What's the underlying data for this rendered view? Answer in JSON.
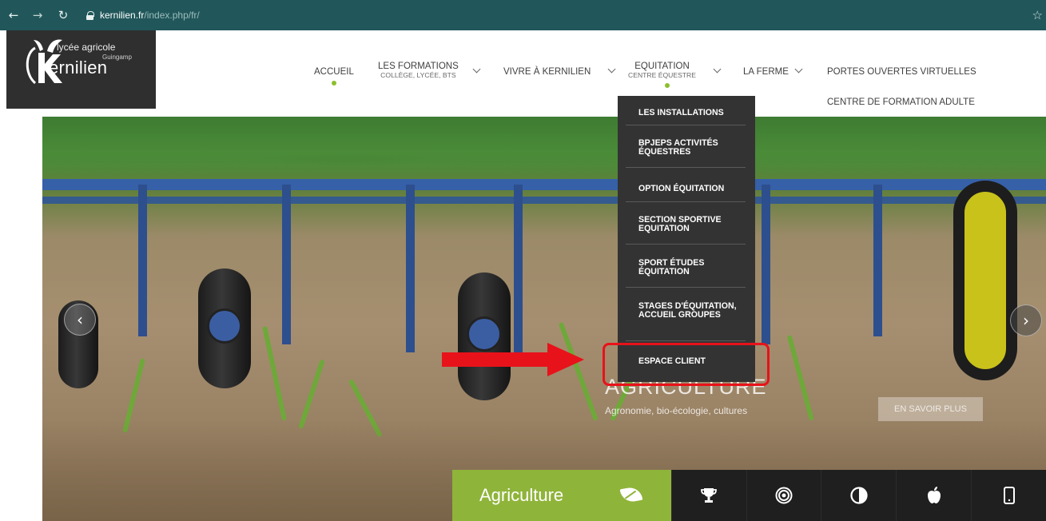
{
  "browser": {
    "url_host": "kernilien.fr",
    "url_path": "/index.php/fr/"
  },
  "logo": {
    "line1": "lycée agricole",
    "line2": "Guingamp",
    "line3": "ernilien"
  },
  "nav": {
    "accueil": "ACCUEIL",
    "formations": "LES FORMATIONS",
    "formations_sub": "COLLÈGE, LYCÉE, BTS",
    "vivre": "VIVRE À KERNILIEN",
    "equitation": "EQUITATION",
    "equitation_sub": "CENTRE ÉQUESTRE",
    "ferme": "LA FERME",
    "portes": "PORTES OUVERTES VIRTUELLES",
    "centre_adulte": "CENTRE DE FORMATION ADULTE"
  },
  "dropdown": {
    "items": [
      "LES INSTALLATIONS",
      "BPJEPS ACTIVITÉS ÉQUESTRES",
      "OPTION ÉQUITATION",
      "SECTION SPORTIVE EQUITATION",
      "SPORT ÉTUDES ÉQUITATION",
      "STAGES D'ÉQUITATION, ACCUEIL GROUPES",
      "ESPACE CLIENT"
    ]
  },
  "slide": {
    "title": "AGRICULTURE",
    "subtitle": "Agronomie, bio-écologie, cultures",
    "button": "EN SAVOIR PLUS"
  },
  "category_bar": {
    "active_label": "Agriculture",
    "tabs": [
      "trophy-icon",
      "target-icon",
      "contrast-icon",
      "apple-icon",
      "mobile-icon"
    ]
  },
  "colors": {
    "browser_bar": "#21575a",
    "accent_green": "#8fb43a",
    "dropdown_bg": "#333333",
    "highlight_red": "#e8121a"
  }
}
